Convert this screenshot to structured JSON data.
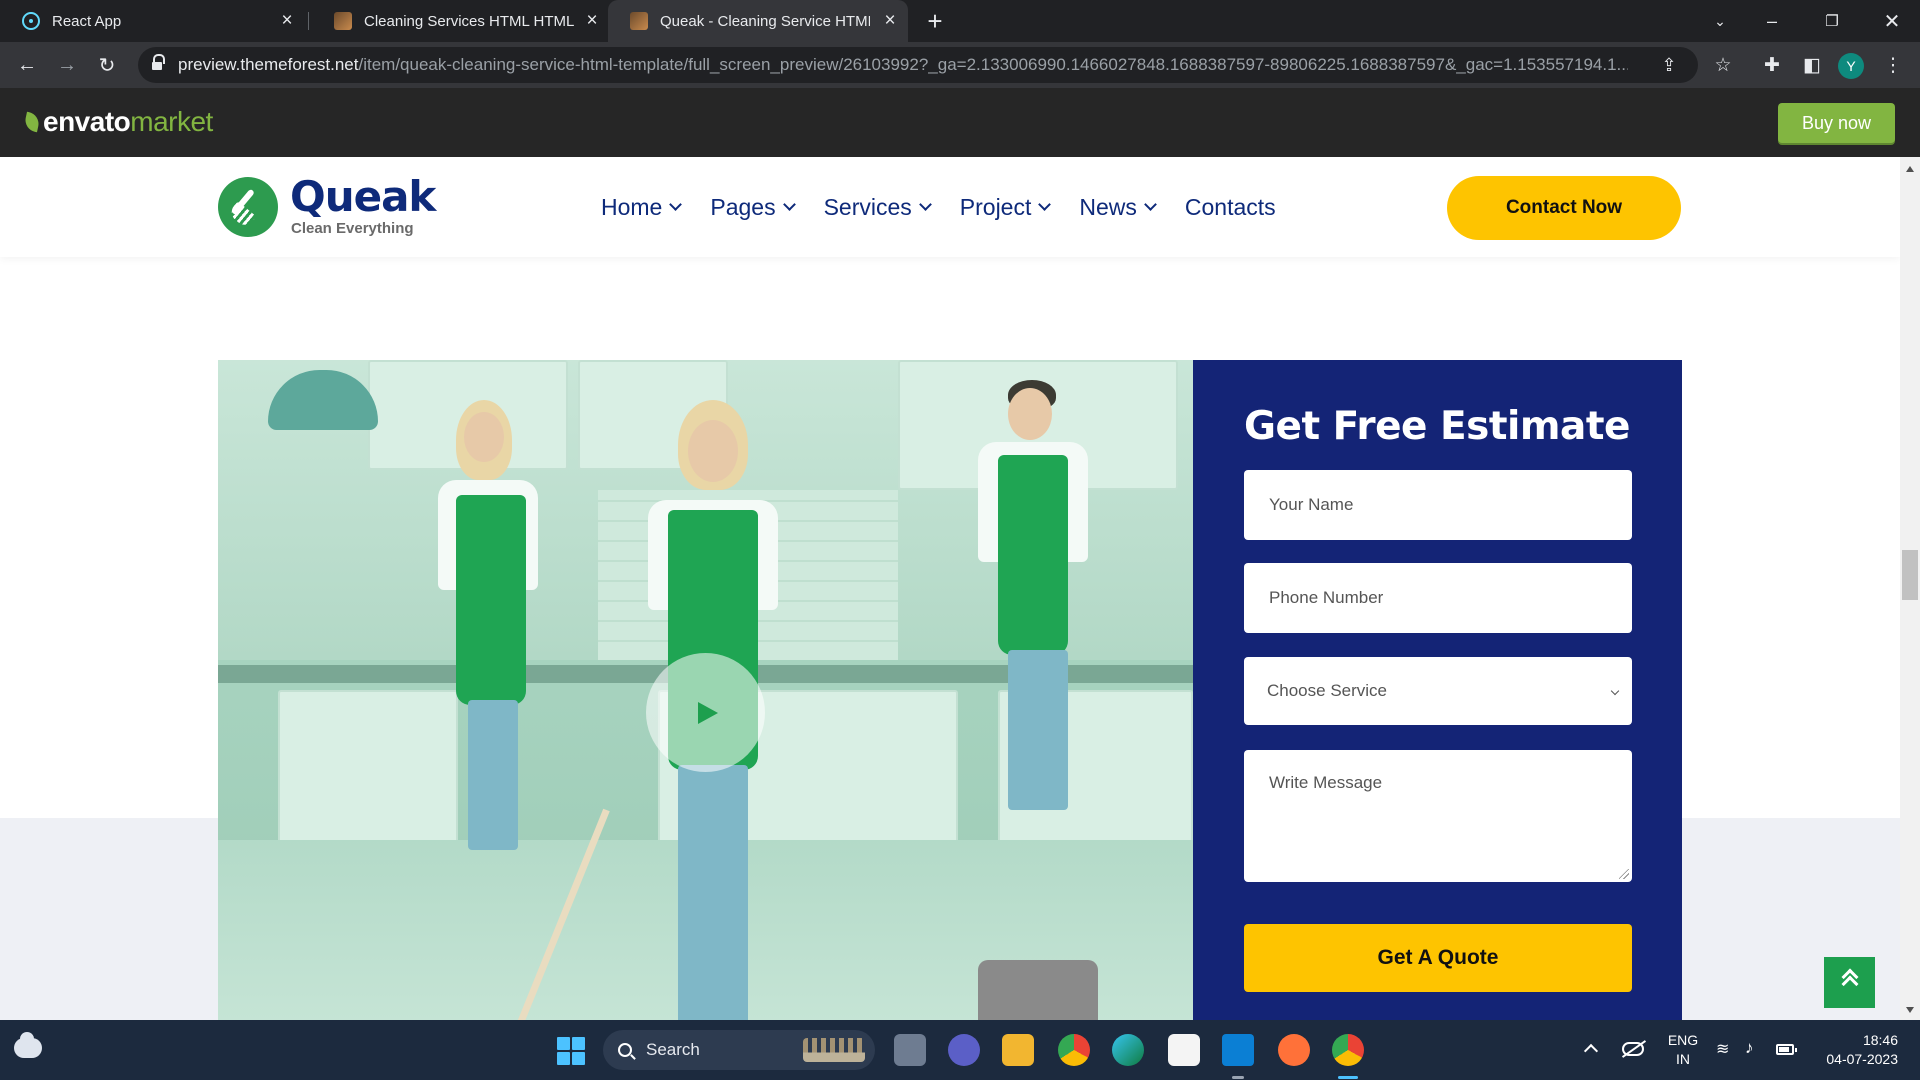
{
  "browser": {
    "tabs": [
      {
        "title": "React App",
        "favicon": "react-icon",
        "active": false
      },
      {
        "title": "Cleaning Services HTML HTML W",
        "favicon": "envato-favicon-icon",
        "active": false
      },
      {
        "title": "Queak - Cleaning Service HTML T",
        "favicon": "envato-favicon-icon",
        "active": true
      }
    ],
    "url_host": "preview.themeforest.net",
    "url_path": "/item/queak-cleaning-service-html-template/full_screen_preview/26103992?_ga=2.133006990.1466027848.1688387597-89806225.1688387597&_gac=1.153557194.1...",
    "profile_initial": "Y"
  },
  "envato": {
    "logo_envato": "envato",
    "logo_market": "market",
    "buy_now_label": "Buy now",
    "accent": "#82b541"
  },
  "site": {
    "name": "Queak",
    "tagline": "Clean Everything",
    "nav": [
      {
        "label": "Home",
        "has_dropdown": true
      },
      {
        "label": "Pages",
        "has_dropdown": true
      },
      {
        "label": "Services",
        "has_dropdown": true
      },
      {
        "label": "Project",
        "has_dropdown": true
      },
      {
        "label": "News",
        "has_dropdown": true
      },
      {
        "label": "Contacts",
        "has_dropdown": false
      }
    ],
    "contact_button": "Contact Now",
    "colors": {
      "navy": "#142476",
      "yellow": "#fec400",
      "green": "#1d9f4e"
    }
  },
  "estimate_form": {
    "title": "Get Free Estimate",
    "name_placeholder": "Your Name",
    "phone_placeholder": "Phone Number",
    "service_selected": "Choose Service",
    "message_placeholder": "Write Message",
    "submit_label": "Get A Quote"
  },
  "taskbar": {
    "search_label": "Search",
    "language_line1": "ENG",
    "language_line2": "IN",
    "time": "18:46",
    "date": "04-07-2023"
  }
}
